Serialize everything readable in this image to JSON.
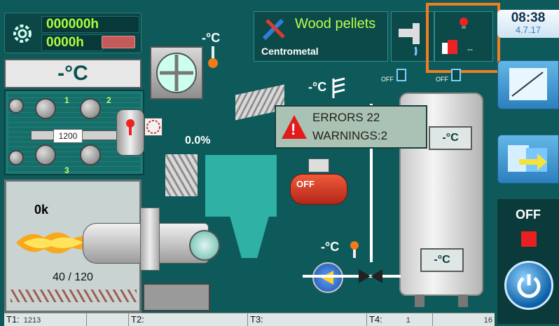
{
  "counters": {
    "hours_total": "000000h",
    "hours_service": "0000h"
  },
  "boiler_temp": "-°C",
  "power_setpoint": "1200",
  "burner": {
    "fuel_amount": "0k",
    "fuel_ratio": "40 / 120"
  },
  "fan_temp": "-°C",
  "feed_percent": "0.0%",
  "fuel": {
    "name": "Wood pellets",
    "brand": "Centrometal"
  },
  "alarm": {
    "value": "--"
  },
  "outdoor_temp": "-°C",
  "off_labels": {
    "left": "OFF",
    "right": "OFF"
  },
  "errors": {
    "errors_text": "ERRORS 22",
    "warnings_text": "WARNINGS:2"
  },
  "compressor_label": "OFF",
  "tank": {
    "top_temp": "-°C",
    "bottom_temp": "-°C"
  },
  "pump_temp": "-°C",
  "clock": {
    "time": "08:38",
    "date": "4.7.17"
  },
  "control": {
    "state_label": "OFF"
  },
  "boiler_labels": {
    "one": "1",
    "two": "2",
    "three": "3"
  },
  "status_bar": [
    {
      "label": "T1:",
      "value": "1213"
    },
    {
      "label": "T2:",
      "value": ""
    },
    {
      "label": "T3:",
      "value": ""
    },
    {
      "label": "T4:",
      "value": "1"
    },
    {
      "label": "",
      "value": "16"
    }
  ],
  "colors": {
    "background": "#0e5a5a",
    "accent_green": "#a9ff3c",
    "highlight_orange": "#ef7d22",
    "stop_red": "#e82020"
  }
}
